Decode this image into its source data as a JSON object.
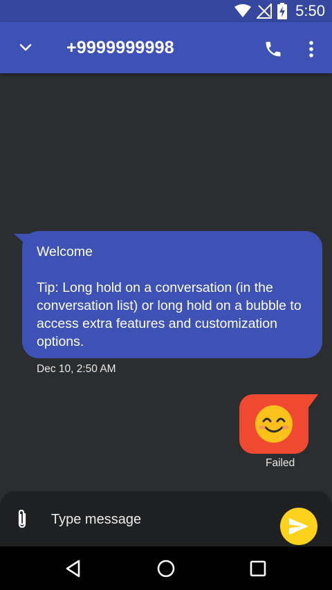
{
  "status_bar": {
    "time": "5:50",
    "icons": [
      "wifi-icon",
      "no-signal-icon",
      "battery-charging-icon"
    ]
  },
  "app_bar": {
    "title": "+9999999998",
    "icons": [
      "chevron-down-icon",
      "phone-icon",
      "more-vert-icon"
    ]
  },
  "conversation": {
    "incoming": {
      "text": "Welcome\n\nTip: Long hold on a conversation (in the conversation list) or long hold on a bubble to access extra features and customization options.",
      "timestamp": "Dec 10, 2:50 AM"
    },
    "outgoing": {
      "emoji": "😊",
      "status": "Failed"
    }
  },
  "composer": {
    "placeholder": "Type message",
    "value": ""
  },
  "nav_bar": {
    "icons": [
      "back-icon",
      "home-icon",
      "recents-icon"
    ]
  },
  "colors": {
    "app_bar": "#3e51b5",
    "status_bar": "#35479f",
    "background": "#2b2d2e",
    "incoming_bubble": "#3e51b5",
    "outgoing_bubble": "#f04932",
    "send_button": "#fdd21d"
  }
}
